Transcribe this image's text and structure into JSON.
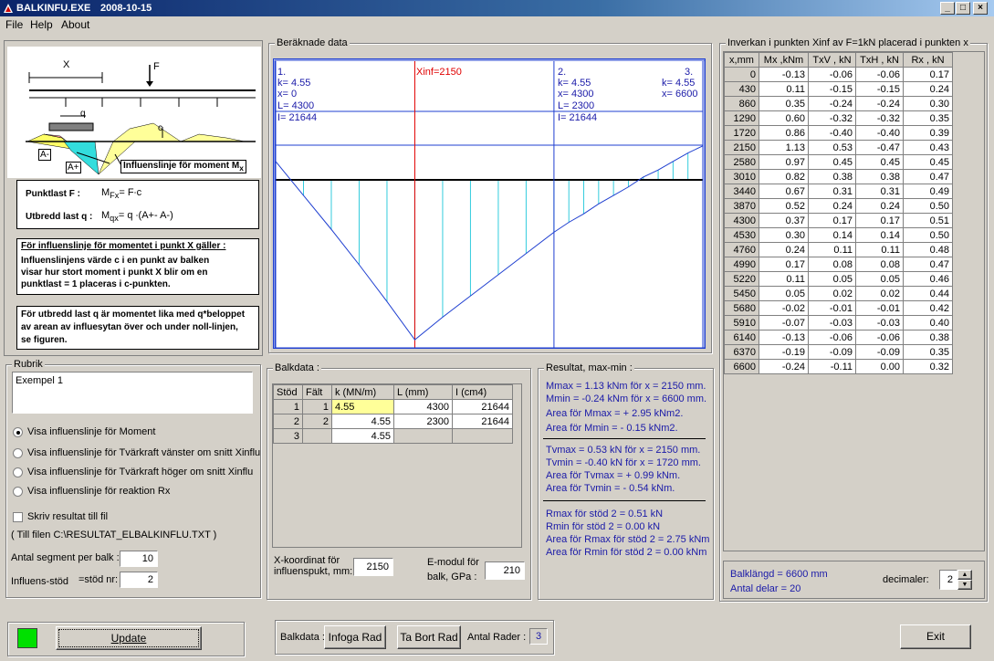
{
  "window": {
    "title": "BALKINFU.EXE",
    "date": "2008-10-15",
    "min": "_",
    "max": "□",
    "close": "×"
  },
  "menu": [
    "File",
    "Help",
    "About"
  ],
  "illustration": {
    "x_label": "X",
    "f_label": "F",
    "q_label": "q",
    "c_label": "c",
    "a_minus": "A-",
    "a_plus": "A+",
    "influence_caption": "Influenslinje för moment M",
    "influence_sub": "x",
    "punktlast_label": "Punktlast F :",
    "punktlast_formula": "M",
    "punktlast_sub": "Fx",
    "punktlast_rhs": "= F∙c",
    "utbredd_label": "Utbredd last q :",
    "utbredd_formula": "M",
    "utbredd_sub": "qx",
    "utbredd_rhs": "= q ∙(A+- A-)"
  },
  "info1": {
    "title": "För influenslinje för momentet i punkt X gäller :",
    "body": [
      "Influenslinjens värde c i en punkt av balken",
      "visar hur stort moment i punkt X blir om en",
      "punktlast = 1 placeras i c-punkten."
    ]
  },
  "info2": {
    "body": [
      "För utbredd last q är momentet lika med q*beloppet",
      "av arean av influesytan över och under noll-linjen,",
      "se figuren."
    ]
  },
  "rubrik": {
    "label": "Rubrik",
    "value": "Exempel 1"
  },
  "options": {
    "radios": [
      {
        "label": "Visa influenslinje för Moment",
        "checked": true
      },
      {
        "label": "Visa influenslinje för Tvärkraft vänster om snitt Xinflu",
        "checked": false
      },
      {
        "label": "Visa influenslinje för Tvärkraft höger om snitt Xinflu",
        "checked": false
      },
      {
        "label": "Visa influenslinje för reaktion Rx",
        "checked": false
      }
    ],
    "write_file_label": "Skriv resultat till fil",
    "file_note": "( Till filen C:\\RESULTAT_ELBALKINFLU.TXT )",
    "segments_label": "Antal segment per balk :",
    "segments_value": "10",
    "stod_label": "Influens-stöd",
    "stod_label2": "=stöd nr:",
    "stod_value": "2"
  },
  "chart": {
    "label": "Beräknade data",
    "xinf_label": "Xinf=2150",
    "support1": [
      "1.",
      "k= 4.55",
      "x= 0",
      "L= 4300",
      "I= 21644"
    ],
    "support2": [
      "2.",
      "k= 4.55",
      "x= 4300",
      "L= 2300",
      "I= 21644"
    ],
    "support3": [
      "3.",
      "k= 4.55",
      "x= 6600"
    ]
  },
  "chart_data": {
    "type": "line",
    "x": [
      0,
      430,
      860,
      1290,
      1720,
      2150,
      2580,
      3010,
      3440,
      3870,
      4300,
      4530,
      4760,
      4990,
      5220,
      5450,
      5680,
      5910,
      6140,
      6370,
      6600
    ],
    "series": [
      {
        "values": [
          -0.13,
          0.11,
          0.35,
          0.6,
          0.86,
          1.13,
          0.97,
          0.82,
          0.67,
          0.52,
          0.37,
          0.3,
          0.24,
          0.17,
          0.11,
          0.05,
          -0.02,
          -0.07,
          -0.13,
          -0.19,
          -0.24
        ]
      }
    ],
    "xlim": [
      0,
      6600
    ],
    "marker_x": 2150,
    "supports_x": [
      0,
      4300,
      6600
    ],
    "colors": {
      "line": "#1f3fd0",
      "fill_lines": "#33ccdd",
      "marker": "#e00000"
    }
  },
  "balkdata": {
    "label": "Balkdata :",
    "headers": [
      "Stöd",
      "Fält",
      "k (MN/m)",
      "L (mm)",
      "I (cm4)"
    ],
    "rows": [
      [
        "1",
        "1",
        "4.55",
        "4300",
        "21644"
      ],
      [
        "2",
        "2",
        "4.55",
        "2300",
        "21644"
      ],
      [
        "3",
        "",
        "4.55",
        "",
        ""
      ]
    ],
    "xkoord_label1": "X-koordinat för",
    "xkoord_label2": "influenspukt, mm:",
    "xkoord_value": "2150",
    "emodul_label1": "E-modul för",
    "emodul_label2": "balk, GPa :",
    "emodul_value": "210"
  },
  "resultat": {
    "label": "Resultat, max-min :",
    "block1": [
      "Mmax = 1.13 kNm för x = 2150 mm.",
      "Mmin = -0.24 kNm för x = 6600 mm.",
      "Area för Mmax = + 2.95 kNm2.",
      "Area för Mmin = - 0.15 kNm2."
    ],
    "block2": [
      "Tvmax = 0.53 kN för x = 2150 mm.",
      "Tvmin = -0.40 kN för x = 1720 mm.",
      "Area för Tvmax = + 0.99 kNm.",
      "Area för Tvmin = - 0.54 kNm."
    ],
    "block3": [
      "Rmax för stöd 2 = 0.51 kN",
      "Rmin för stöd 2 = 0.00 kN",
      "Area för Rmax för stöd 2 = 2.75 kNm",
      "Area för Rmin för stöd 2 = 0.00 kNm"
    ]
  },
  "inverkan": {
    "label": "Inverkan i punkten Xinf av F=1kN placerad i punkten x",
    "headers": [
      "x,mm",
      "Mx ,kNm",
      "TxV , kN",
      "TxH , kN",
      "Rx , kN"
    ],
    "rows": [
      [
        "0",
        "-0.13",
        "-0.06",
        "-0.06",
        "0.17"
      ],
      [
        "430",
        "0.11",
        "-0.15",
        "-0.15",
        "0.24"
      ],
      [
        "860",
        "0.35",
        "-0.24",
        "-0.24",
        "0.30"
      ],
      [
        "1290",
        "0.60",
        "-0.32",
        "-0.32",
        "0.35"
      ],
      [
        "1720",
        "0.86",
        "-0.40",
        "-0.40",
        "0.39"
      ],
      [
        "2150",
        "1.13",
        "0.53",
        "-0.47",
        "0.43"
      ],
      [
        "2580",
        "0.97",
        "0.45",
        "0.45",
        "0.45"
      ],
      [
        "3010",
        "0.82",
        "0.38",
        "0.38",
        "0.47"
      ],
      [
        "3440",
        "0.67",
        "0.31",
        "0.31",
        "0.49"
      ],
      [
        "3870",
        "0.52",
        "0.24",
        "0.24",
        "0.50"
      ],
      [
        "4300",
        "0.37",
        "0.17",
        "0.17",
        "0.51"
      ],
      [
        "4530",
        "0.30",
        "0.14",
        "0.14",
        "0.50"
      ],
      [
        "4760",
        "0.24",
        "0.11",
        "0.11",
        "0.48"
      ],
      [
        "4990",
        "0.17",
        "0.08",
        "0.08",
        "0.47"
      ],
      [
        "5220",
        "0.11",
        "0.05",
        "0.05",
        "0.46"
      ],
      [
        "5450",
        "0.05",
        "0.02",
        "0.02",
        "0.44"
      ],
      [
        "5680",
        "-0.02",
        "-0.01",
        "-0.01",
        "0.42"
      ],
      [
        "5910",
        "-0.07",
        "-0.03",
        "-0.03",
        "0.40"
      ],
      [
        "6140",
        "-0.13",
        "-0.06",
        "-0.06",
        "0.38"
      ],
      [
        "6370",
        "-0.19",
        "-0.09",
        "-0.09",
        "0.35"
      ],
      [
        "6600",
        "-0.24",
        "-0.11",
        "0.00",
        "0.32"
      ]
    ],
    "balklangd": "Balklängd = 6600 mm",
    "antal_delar": "Antal delar = 20",
    "decimaler_label": "decimaler:",
    "decimaler_value": "2"
  },
  "bottom": {
    "update_label": "Update",
    "balkdata_label": "Balkdata :",
    "infoga_label": "Infoga Rad",
    "tabort_label": "Ta Bort Rad",
    "antal_rader_label": "Antal Rader :",
    "antal_rader_value": "3",
    "exit_label": "Exit",
    "status_color": "#00e000"
  }
}
